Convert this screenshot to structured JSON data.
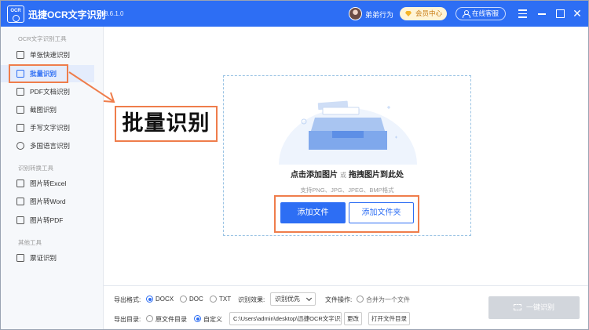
{
  "app": {
    "logo_text": "OCR",
    "title": "迅捷OCR文字识别",
    "version": "v8.6.1.0",
    "username": "弟弟行为",
    "vip_label": "会员中心",
    "service_label": "在线客服"
  },
  "sidebar": {
    "sections": [
      {
        "label": "OCR文字识别工具",
        "items": [
          {
            "label": "单张快速识别",
            "icon": "image-icon"
          },
          {
            "label": "批量识别",
            "icon": "copy-icon",
            "active": true
          },
          {
            "label": "PDF文档识别",
            "icon": "pdf-icon"
          },
          {
            "label": "截图识别",
            "icon": "crop-icon"
          },
          {
            "label": "手写文字识别",
            "icon": "pen-icon"
          },
          {
            "label": "多国语言识别",
            "icon": "globe-icon"
          }
        ]
      },
      {
        "label": "识别转换工具",
        "items": [
          {
            "label": "图片转Excel",
            "icon": "excel-icon"
          },
          {
            "label": "图片转Word",
            "icon": "word-icon"
          },
          {
            "label": "图片转PDF",
            "icon": "pdf-icon"
          }
        ]
      },
      {
        "label": "其他工具",
        "items": [
          {
            "label": "票证识别",
            "icon": "ticket-icon"
          }
        ]
      }
    ]
  },
  "annotation": {
    "callout": "批量识别"
  },
  "dropzone": {
    "title_left": "点击添加图片",
    "title_or": "或",
    "title_right": "拖拽图片到此处",
    "hint": "支持PNG、JPG、JPEG、BMP格式",
    "add_file": "添加文件",
    "add_folder": "添加文件夹"
  },
  "bottom": {
    "format_label": "导出格式:",
    "format_options": [
      "DOCX",
      "DOC",
      "TXT"
    ],
    "format_selected": "DOCX",
    "effect_label": "识别效果:",
    "effect_value": "识别优先",
    "file_op_label": "文件操作:",
    "merge_label": "合并为一个文件",
    "dir_label": "导出目录:",
    "dir_options": [
      "原文件目录",
      "自定义"
    ],
    "dir_selected": "自定义",
    "path": "C:\\Users\\admin\\desktop\\迅捷OCR文字识别",
    "change_btn": "更改",
    "open_dir_btn": "打开文件目录",
    "ocr_btn": "一键识别"
  },
  "colors": {
    "primary": "#2d6ef4",
    "highlight": "#ef7d4b",
    "disabled": "#d2d6dc"
  }
}
